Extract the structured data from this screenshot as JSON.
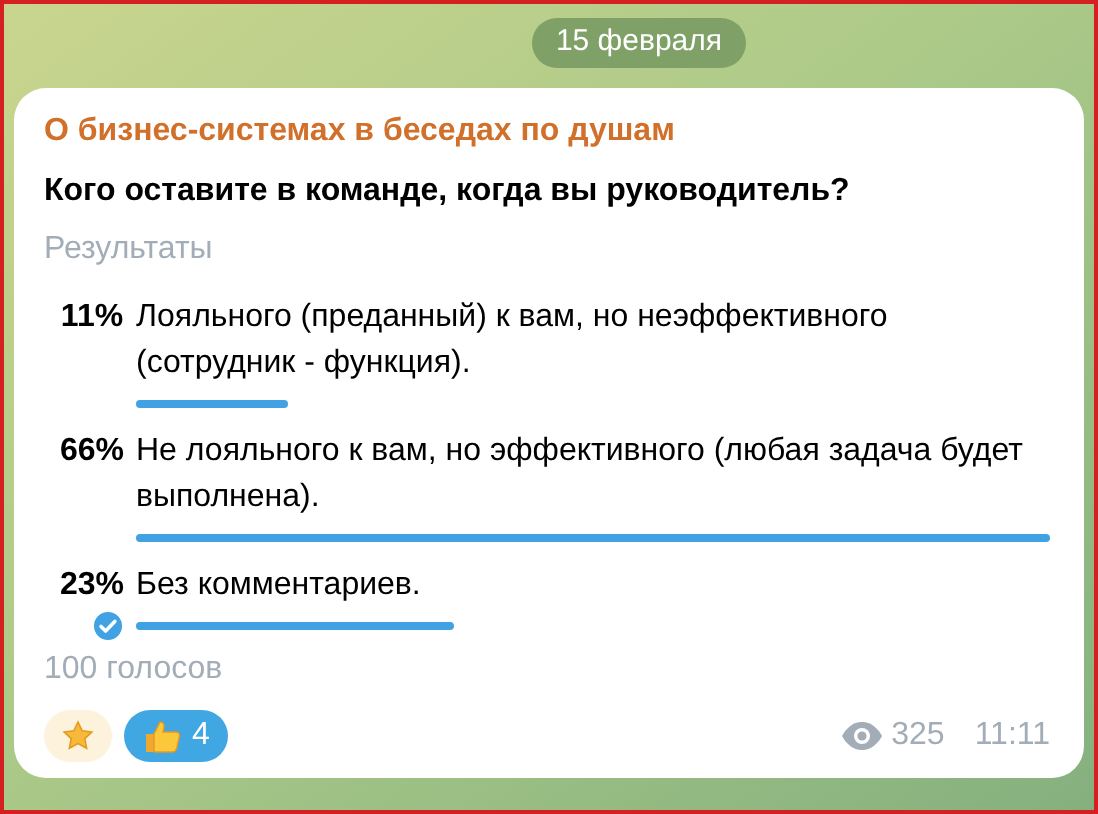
{
  "date_badge": "15 февраля",
  "message": {
    "channel": "О бизнес-системах в беседах по душам",
    "poll": {
      "question": "Кого оставите в команде, когда вы руководитель?",
      "type_label": "Результаты",
      "options": [
        {
          "percent": "11%",
          "text": "Лояльного (преданный) к вам, но неэффективного (сотрудник - функция).",
          "selected": false
        },
        {
          "percent": "66%",
          "text": "Не лояльного к вам, но эффективного (любая задача будет выполнена).",
          "selected": false
        },
        {
          "percent": "23%",
          "text": "Без комментариев.",
          "selected": true
        }
      ],
      "votes": "100 голосов"
    },
    "reactions": [
      {
        "kind": "star",
        "chosen": false
      },
      {
        "kind": "thumbs_up",
        "count": "4",
        "chosen": true
      }
    ],
    "views": "325",
    "time": "11:11"
  }
}
